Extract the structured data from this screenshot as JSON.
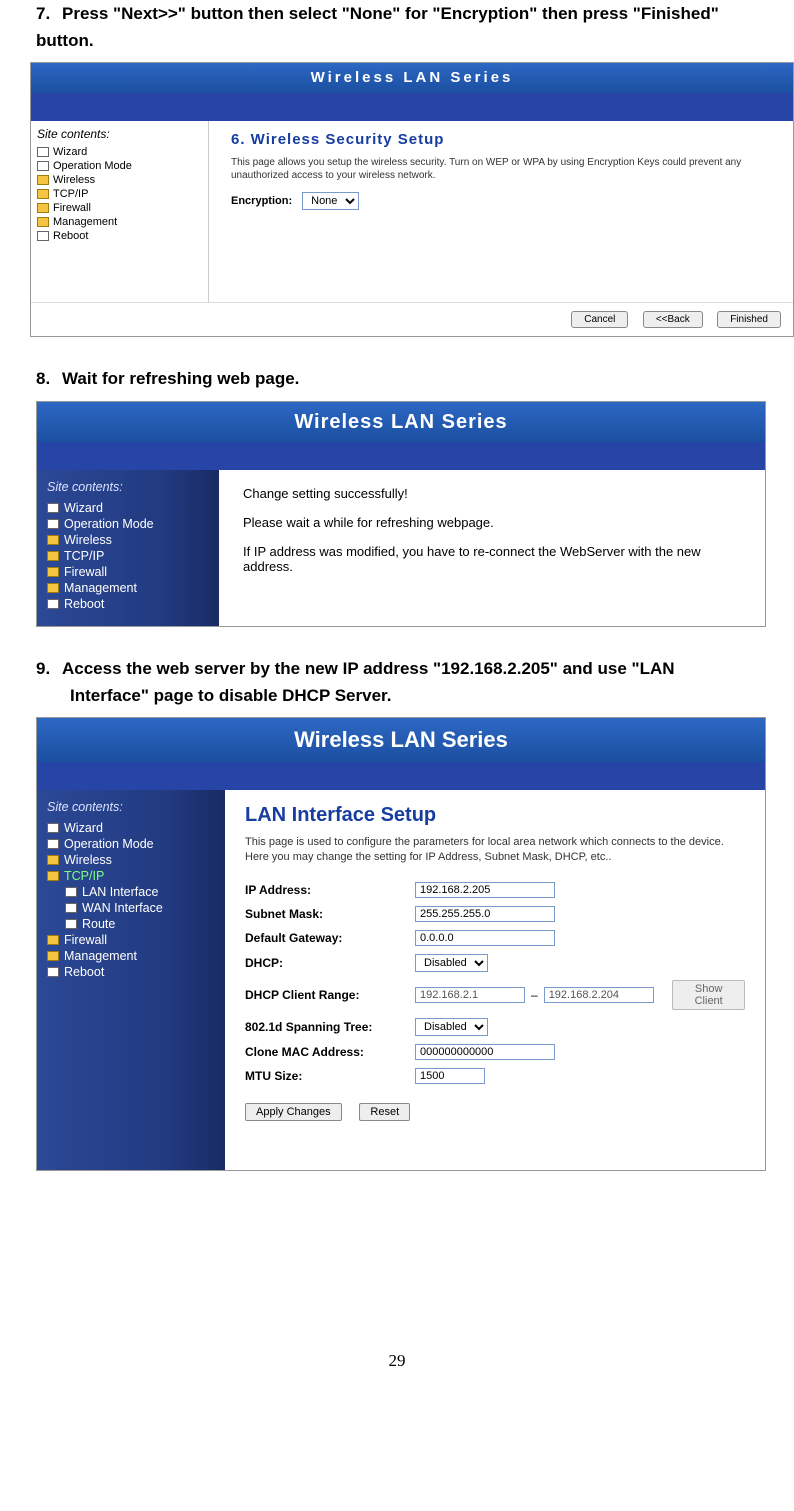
{
  "steps": {
    "s7": "Press \"Next>>\" button then select \"None\" for \"Encryption\" then press \"Finished\" button.",
    "s8": "Wait for refreshing web page.",
    "s9a": "Access the web server by the new IP address \"192.168.2.205\" and use \"LAN",
    "s9b": "Interface\" page to disable DHCP Server."
  },
  "wlan_title": "Wireless LAN Series",
  "site_contents": "Site contents:",
  "nav1": [
    "Wizard",
    "Operation Mode",
    "Wireless",
    "TCP/IP",
    "Firewall",
    "Management",
    "Reboot"
  ],
  "fig1": {
    "title": "6. Wireless Security Setup",
    "desc": "This page allows you setup the wireless security. Turn on WEP or WPA by using Encryption Keys could prevent any unauthorized access to your wireless network.",
    "enc_label": "Encryption:",
    "enc_value": "None",
    "btns": {
      "cancel": "Cancel",
      "back": "<<Back",
      "finished": "Finished"
    }
  },
  "fig2": {
    "line1": "Change setting successfully!",
    "line2": "Please wait a while for refreshing webpage.",
    "line3": "If IP address was modified, you have to re-connect the WebServer with the new address."
  },
  "nav3": {
    "top": [
      "Wizard",
      "Operation Mode",
      "Wireless"
    ],
    "tcpip": "TCP/IP",
    "tcpip_sub": [
      "LAN Interface",
      "WAN Interface",
      "Route"
    ],
    "bottom": [
      "Firewall",
      "Management",
      "Reboot"
    ]
  },
  "fig3": {
    "title": "LAN Interface Setup",
    "desc": "This page is used to configure the parameters for local area network which connects to the device. Here you may change the setting for IP Address, Subnet Mask, DHCP, etc..",
    "rows": {
      "ip_label": "IP Address:",
      "ip_val": "192.168.2.205",
      "mask_label": "Subnet Mask:",
      "mask_val": "255.255.255.0",
      "gw_label": "Default Gateway:",
      "gw_val": "0.0.0.0",
      "dhcp_label": "DHCP:",
      "dhcp_val": "Disabled",
      "range_label": "DHCP Client Range:",
      "range_from": "192.168.2.1",
      "range_to": "192.168.2.204",
      "show_client": "Show Client",
      "span_label": "802.1d Spanning Tree:",
      "span_val": "Disabled",
      "mac_label": "Clone MAC Address:",
      "mac_val": "000000000000",
      "mtu_label": "MTU Size:",
      "mtu_val": "1500"
    },
    "btns": {
      "apply": "Apply Changes",
      "reset": "Reset"
    }
  },
  "page_no": "29"
}
